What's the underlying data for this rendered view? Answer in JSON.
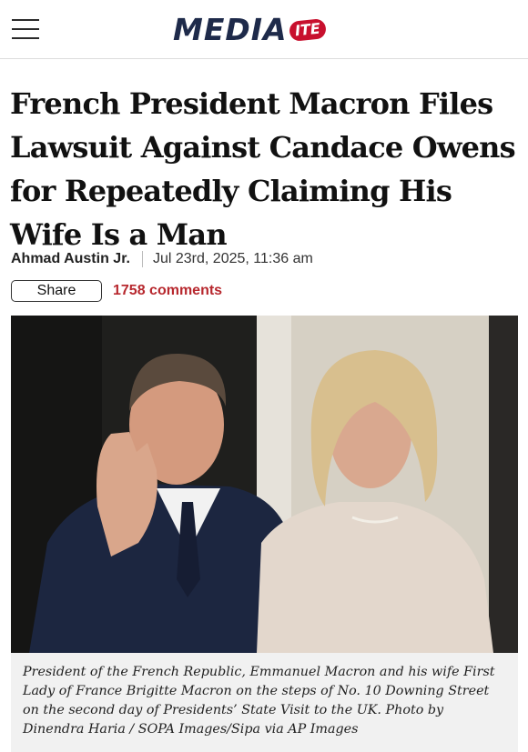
{
  "header": {
    "menu_icon": "hamburger-menu-icon",
    "logo_main": "MEDIA",
    "logo_badge": "ITE"
  },
  "article": {
    "headline": "French President Macron Files Lawsuit Against Candace Owens for Repeatedly Claiming His Wife Is a Man",
    "author": "Ahmad Austin Jr.",
    "date": "Jul 23rd, 2025, 11:36 am",
    "share_label": "Share",
    "comments_label": "1758 comments",
    "caption": "President of the French Republic, Emmanuel Macron and his wife First Lady of France Brigitte Macron on the steps of No. 10 Downing Street on the second day of Presidents’ State Visit to the UK. Photo by Dinendra Haria / SOPA Images/Sipa via AP Images"
  },
  "colors": {
    "logo_navy": "#1e2a4a",
    "brand_red": "#c8102e",
    "comments_red": "#b7282e",
    "caption_bg": "#f1f1f1"
  }
}
